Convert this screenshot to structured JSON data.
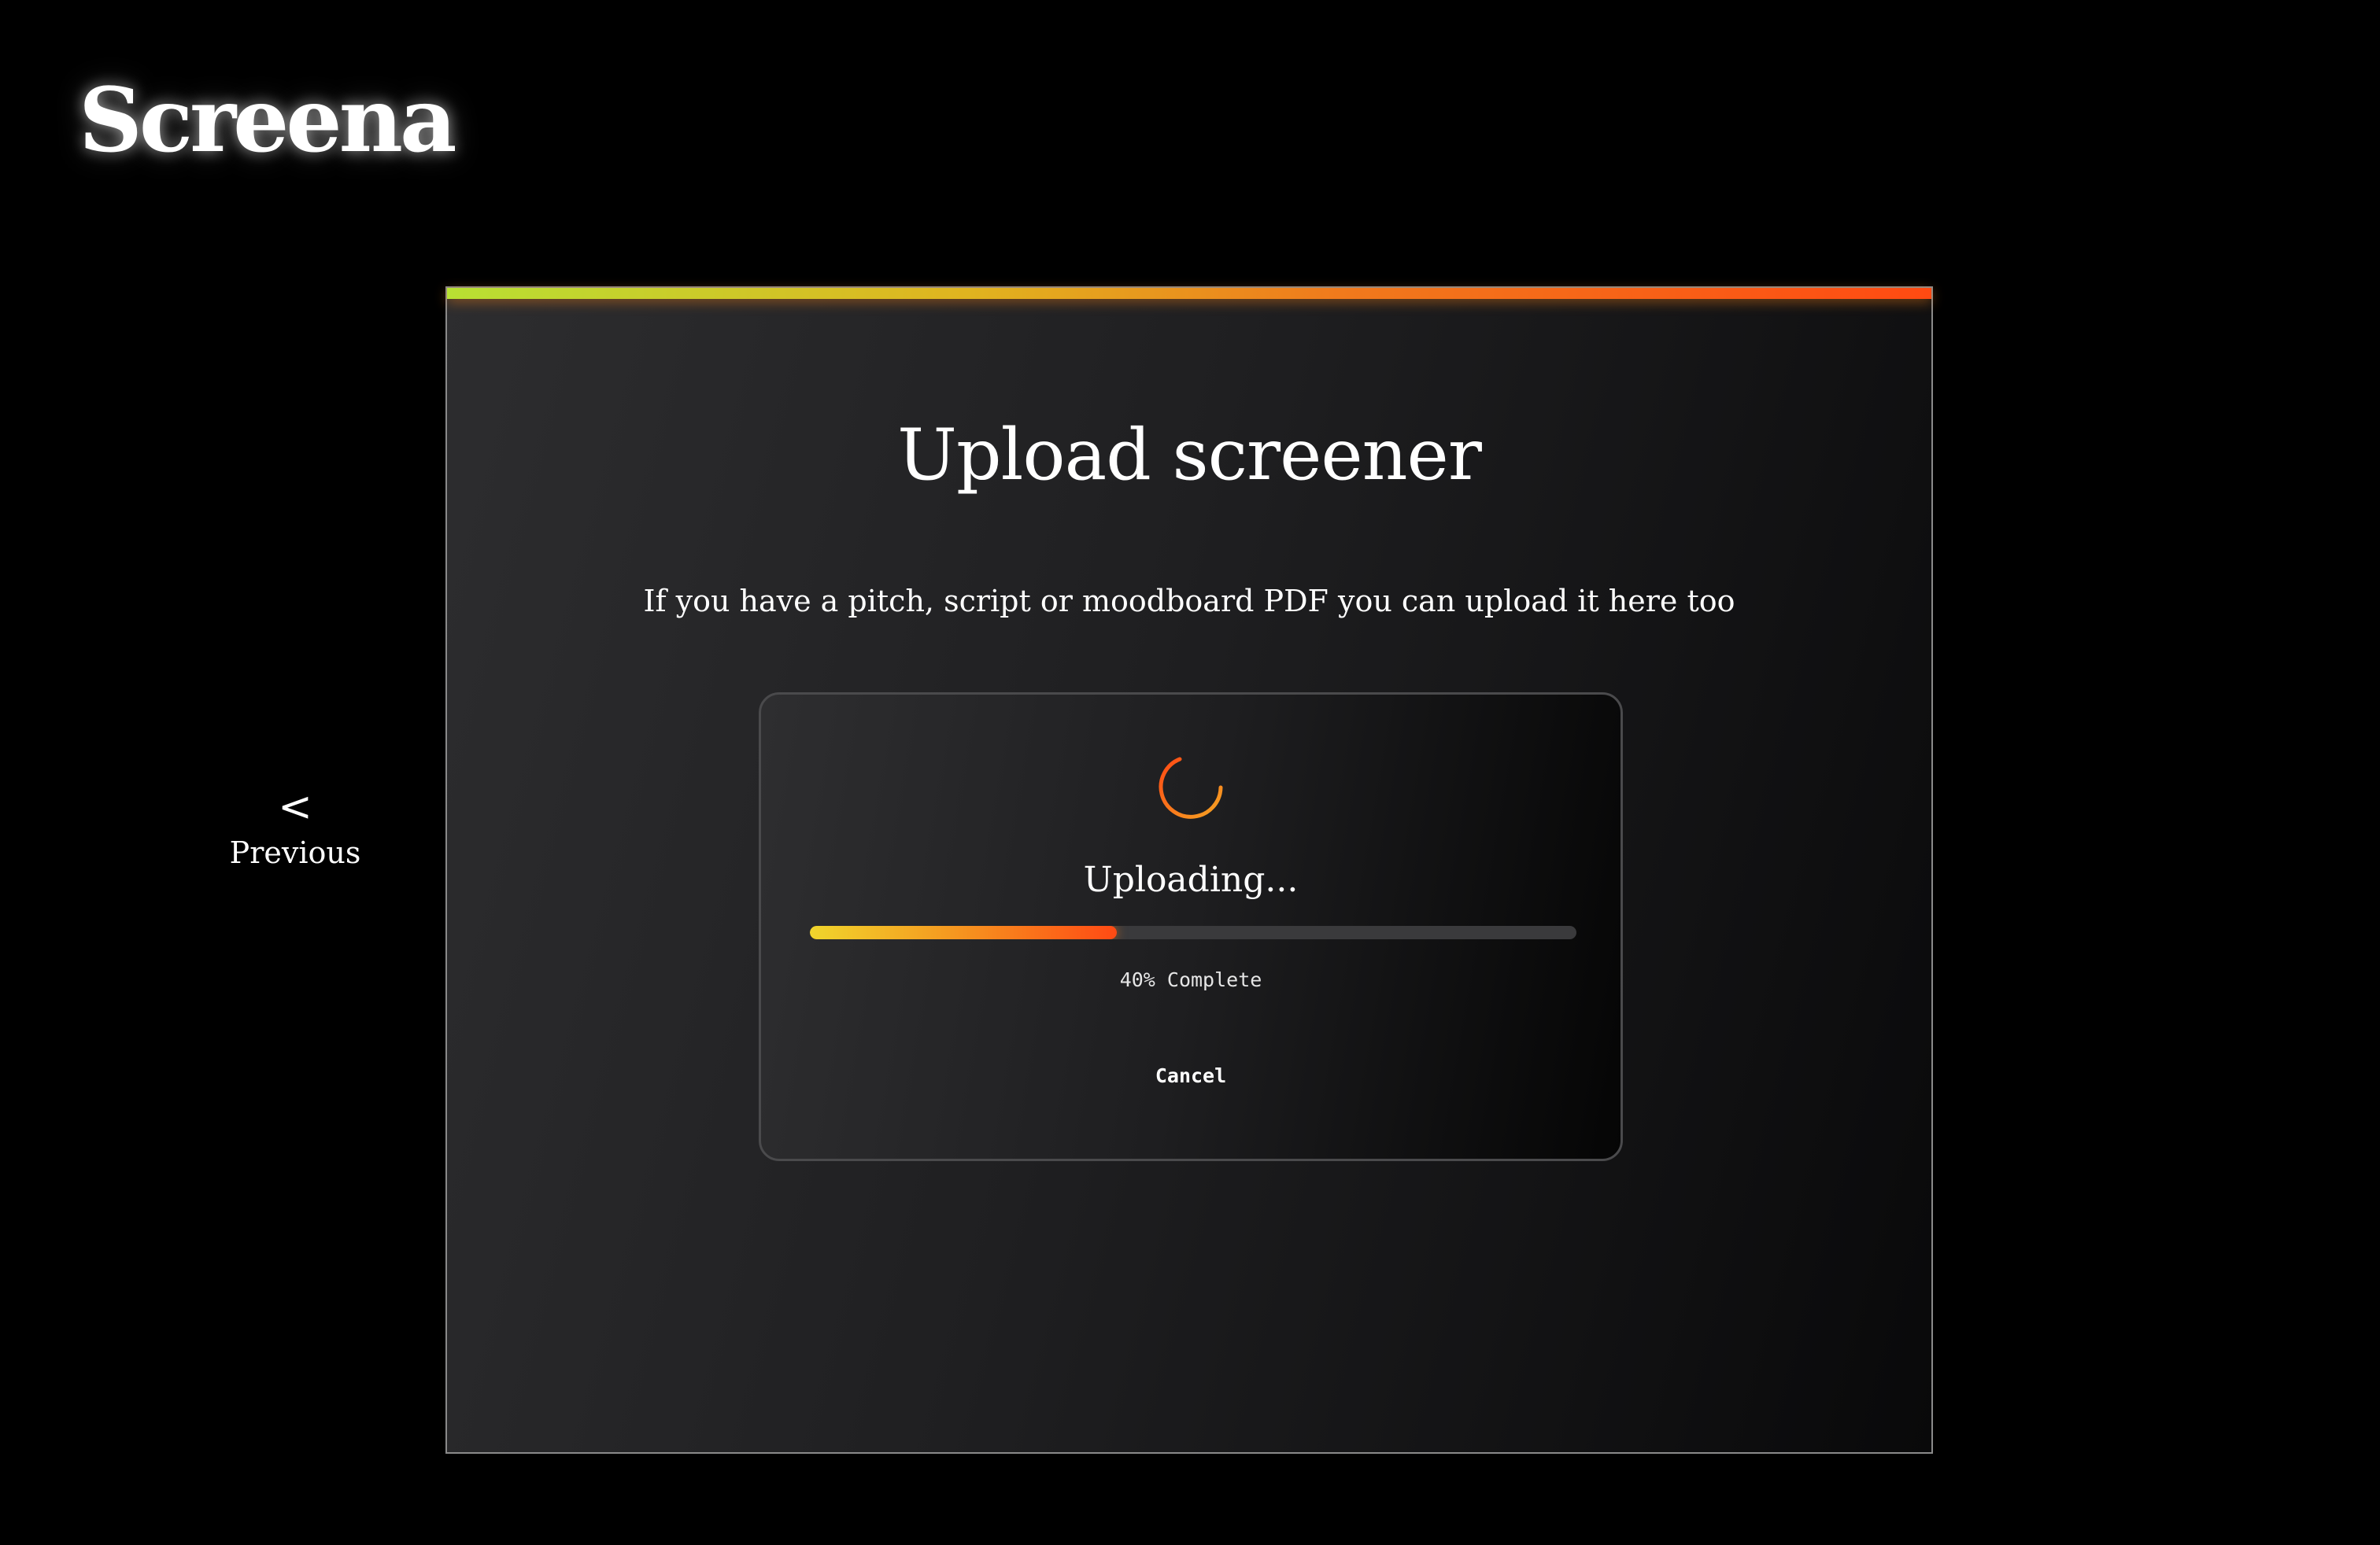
{
  "brand": {
    "name": "Screena"
  },
  "nav": {
    "previous_icon": "<",
    "previous_label": "Previous"
  },
  "panel": {
    "title": "Upload screener",
    "subtitle": "If you have a pitch, script or moodboard PDF you can upload it here too"
  },
  "upload": {
    "status": "Uploading...",
    "progress_percent": 40,
    "progress_text": "40% Complete",
    "cancel_label": "Cancel",
    "spinner_icon": "loading-spinner-icon"
  },
  "colors": {
    "background": "#000000",
    "accent_start": "#b8e033",
    "accent_mid": "#f07a1c",
    "accent_end": "#ff4a12",
    "progress_start": "#f0d52c",
    "progress_end": "#ff4a14"
  }
}
